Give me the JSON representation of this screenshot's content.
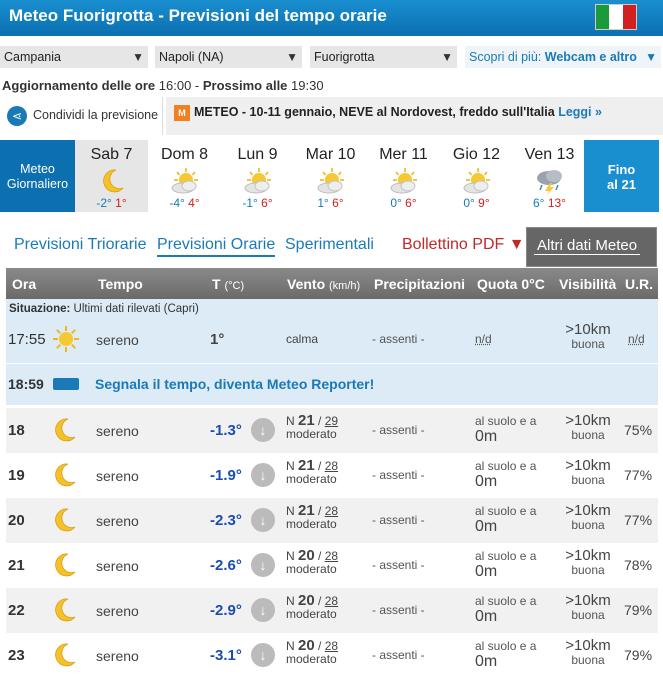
{
  "header": {
    "title": "Meteo Fuorigrotta - Previsioni del tempo orarie"
  },
  "selects": {
    "region": "Campania",
    "province": "Napoli (NA)",
    "locality": "Fuorigrotta",
    "more_prefix": "Scopri di più:",
    "more_value": "Webcam e altro"
  },
  "update": {
    "label": "Aggiornamento delle ore",
    "time": "16:00",
    "sep": " - ",
    "next_label": "Prossimo alle",
    "next_time": "19:30"
  },
  "share": {
    "label": "Condividi la previsione"
  },
  "news": {
    "badge": "M",
    "text": "METEO - 10-11 gennaio, NEVE al Nordovest, freddo sull'Italia",
    "link": "Leggi »"
  },
  "days": {
    "left": [
      "Meteo",
      "Giornaliero"
    ],
    "right": [
      "Fino",
      "al 21"
    ],
    "items": [
      {
        "name": "Sab 7",
        "min": "-2°",
        "max": "1°",
        "icon": "moon-icon"
      },
      {
        "name": "Dom 8",
        "min": "-4°",
        "max": "4°",
        "icon": "sun-cloud-icon"
      },
      {
        "name": "Lun 9",
        "min": "-1°",
        "max": "6°",
        "icon": "sun-cloud-icon"
      },
      {
        "name": "Mar 10",
        "min": "1°",
        "max": "6°",
        "icon": "sun-cloud-icon"
      },
      {
        "name": "Mer 11",
        "min": "0°",
        "max": "6°",
        "icon": "sun-cloud-icon"
      },
      {
        "name": "Gio 12",
        "min": "0°",
        "max": "9°",
        "icon": "sun-cloud-icon"
      },
      {
        "name": "Ven 13",
        "min": "6°",
        "max": "13°",
        "icon": "storm-cloud-icon"
      }
    ]
  },
  "tabs": {
    "triorarie": "Previsioni Triorarie",
    "orarie": "Previsioni Orarie",
    "sperimentali": "Sperimentali",
    "pdf": "Bollettino PDF ▼",
    "altri": "Altri dati Meteo"
  },
  "table": {
    "headers": {
      "ora": "Ora",
      "tempo": "Tempo",
      "t": "T",
      "t_unit": "(°C)",
      "vento": "Vento",
      "vento_unit": "(km/h)",
      "prec": "Precipitazioni",
      "quota": "Quota 0°C",
      "vis": "Visibilità",
      "ur": "U.R."
    },
    "situation": {
      "label_bold": "Situazione:",
      "label": "Ultimi dati rilevati (Capri)",
      "hour": "17:55",
      "sky": "sereno",
      "temp": "1°",
      "wind": "calma",
      "prec": "- assenti -",
      "quota": "n/d",
      "vis": ">10km",
      "vis_q": "buona",
      "ur": "n/d"
    },
    "reporter": {
      "hour": "18:59",
      "text": "Segnala il tempo, diventa Meteo Reporter!"
    },
    "rows": [
      {
        "hour": "18",
        "sky": "sereno",
        "temp": "-1.3°",
        "dir": "N",
        "speed": "21",
        "gust": "29",
        "wlabel": "moderato",
        "prec": "- assenti -",
        "q1": "al suolo e a",
        "q2": "0m",
        "vis": ">10km",
        "vis_q": "buona",
        "ur": "75%"
      },
      {
        "hour": "19",
        "sky": "sereno",
        "temp": "-1.9°",
        "dir": "N",
        "speed": "21",
        "gust": "28",
        "wlabel": "moderato",
        "prec": "- assenti -",
        "q1": "al suolo e a",
        "q2": "0m",
        "vis": ">10km",
        "vis_q": "buona",
        "ur": "77%"
      },
      {
        "hour": "20",
        "sky": "sereno",
        "temp": "-2.3°",
        "dir": "N",
        "speed": "21",
        "gust": "28",
        "wlabel": "moderato",
        "prec": "- assenti -",
        "q1": "al suolo e a",
        "q2": "0m",
        "vis": ">10km",
        "vis_q": "buona",
        "ur": "77%"
      },
      {
        "hour": "21",
        "sky": "sereno",
        "temp": "-2.6°",
        "dir": "N",
        "speed": "20",
        "gust": "28",
        "wlabel": "moderato",
        "prec": "- assenti -",
        "q1": "al suolo e a",
        "q2": "0m",
        "vis": ">10km",
        "vis_q": "buona",
        "ur": "78%"
      },
      {
        "hour": "22",
        "sky": "sereno",
        "temp": "-2.9°",
        "dir": "N",
        "speed": "20",
        "gust": "28",
        "wlabel": "moderato",
        "prec": "- assenti -",
        "q1": "al suolo e a",
        "q2": "0m",
        "vis": ">10km",
        "vis_q": "buona",
        "ur": "79%"
      },
      {
        "hour": "23",
        "sky": "sereno",
        "temp": "-3.1°",
        "dir": "N",
        "speed": "20",
        "gust": "28",
        "wlabel": "moderato",
        "prec": "- assenti -",
        "q1": "al suolo e a",
        "q2": "0m",
        "vis": ">10km",
        "vis_q": "buona",
        "ur": "79%"
      }
    ]
  },
  "colors": {
    "brand_blue": "#0b6fb0",
    "row_alt": "#f1f1f1",
    "temp_blue": "#1a4db0",
    "max_red": "#d02020"
  }
}
